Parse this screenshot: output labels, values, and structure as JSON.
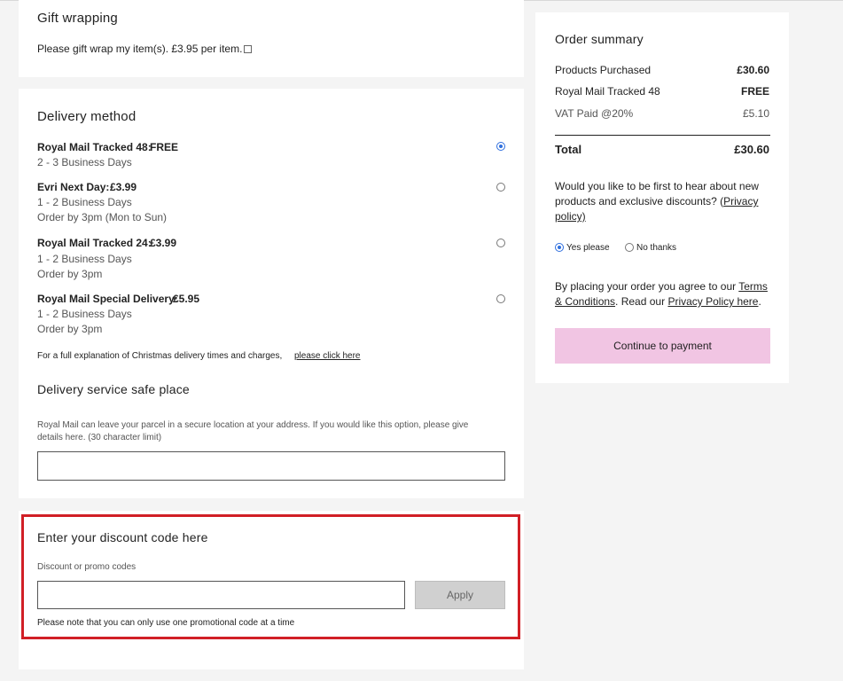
{
  "gift": {
    "title": "Gift wrapping",
    "checkbox_label": "Please gift wrap my item(s). £3.95 per item."
  },
  "delivery": {
    "title": "Delivery method",
    "options": [
      {
        "name": "Royal Mail Tracked 48:",
        "price": "FREE",
        "line1": "2 - 3 Business Days",
        "line2": "",
        "selected": true
      },
      {
        "name": "Evri Next Day:",
        "price": "£3.99",
        "line1": "1 - 2 Business Days",
        "line2": "Order by 3pm (Mon to Sun)",
        "selected": false
      },
      {
        "name": "Royal Mail Tracked 24:",
        "price": "£3.99",
        "line1": "1 - 2 Business Days",
        "line2": "Order by 3pm",
        "selected": false
      },
      {
        "name": "Royal Mail Special Delivery:",
        "price": "£5.95",
        "line1": "1 - 2 Business Days",
        "line2": "Order by 3pm",
        "selected": false
      }
    ],
    "christmas_note": "For a full explanation of Christmas delivery times and charges,",
    "christmas_link": "please click here"
  },
  "safe_place": {
    "title": "Delivery service safe place",
    "description_line1": "Royal Mail can leave your parcel in a secure location at your address. If you would like this option, please give",
    "description_line2": "details here. (30 character limit)",
    "value": ""
  },
  "discount": {
    "title": "Enter your discount code here",
    "label": "Discount or promo codes",
    "value": "",
    "apply_label": "Apply",
    "note": "Please note that you can only use one promotional code at a time"
  },
  "summary": {
    "title": "Order summary",
    "rows": [
      {
        "label": "Products Purchased",
        "value": "£30.60"
      },
      {
        "label": "Royal Mail Tracked 48",
        "value": "FREE"
      },
      {
        "label": "VAT Paid @20%",
        "value": "£5.10"
      }
    ],
    "total_label": "Total",
    "total_value": "£30.60",
    "marketing_line1": "Would you like to be first to hear about new",
    "marketing_line2_pre": "products and exclusive discounts? (",
    "marketing_link_a": "Privacy",
    "marketing_link_b": "policy)",
    "yes_label": "Yes please",
    "no_label": "No thanks",
    "terms_pre": "By placing your order you agree to our",
    "terms_link_a": "Terms",
    "terms_link_b": "& Conditions",
    "terms_mid": ". Read our",
    "privacy_link": "Privacy Policy here",
    "terms_end": ".",
    "pay_label": "Continue to payment"
  },
  "colors": {
    "accent_blue": "#2f6fde",
    "highlight_red": "#d11f26",
    "pay_pink": "#f1c5e3",
    "apply_grey": "#d0d0d0"
  }
}
